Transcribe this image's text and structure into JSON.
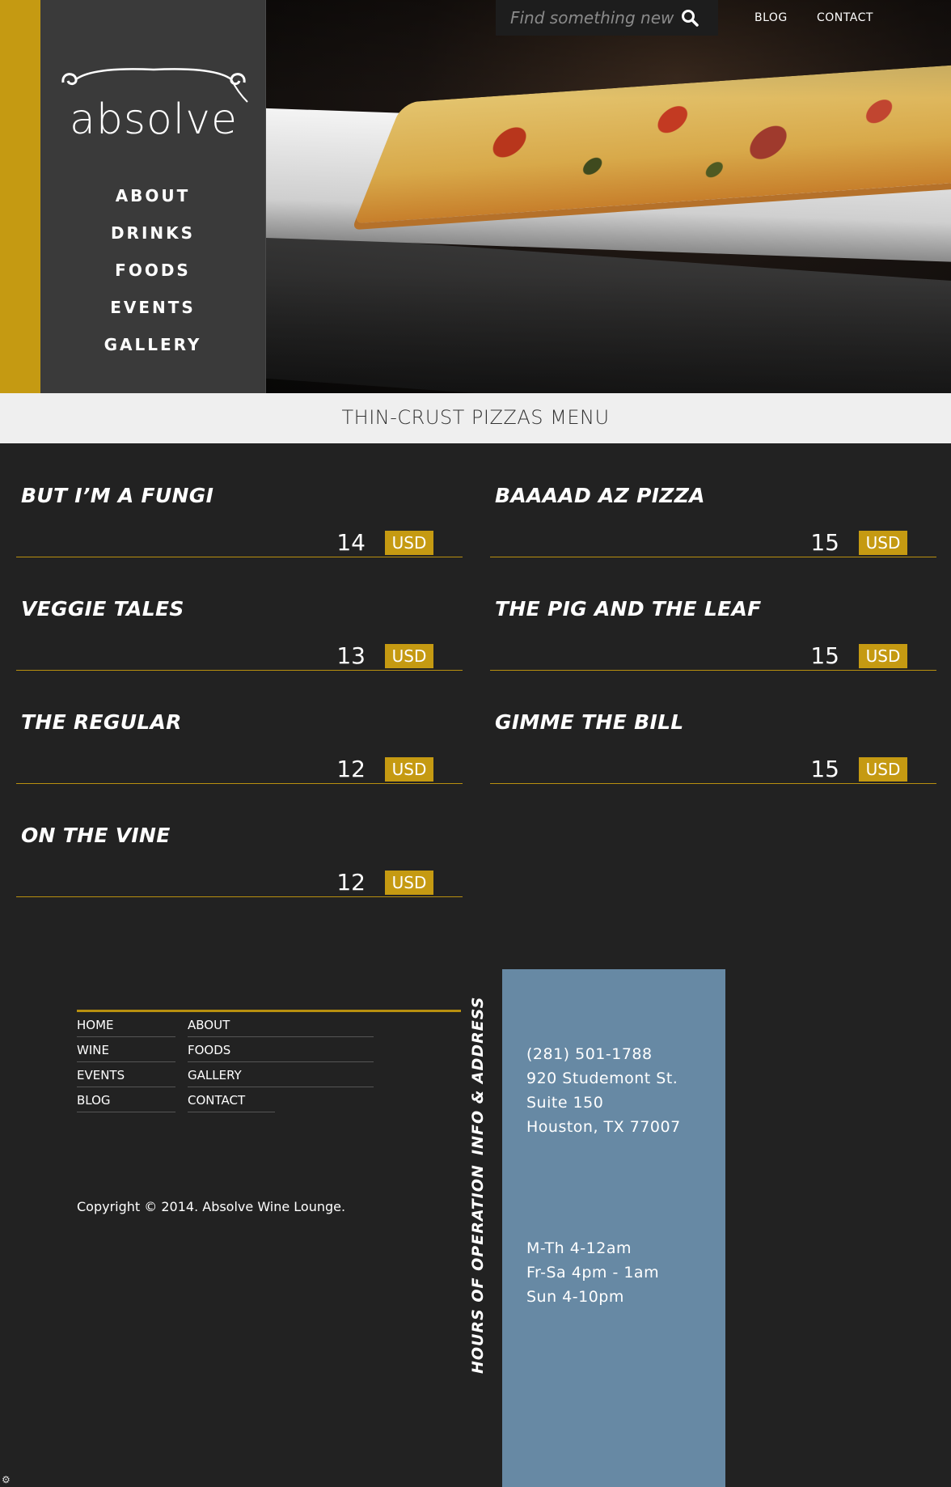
{
  "brand": {
    "logo_text": "absolve",
    "accent": "#c59a12",
    "panel_color": "#6789a4"
  },
  "sidebar": {
    "items": [
      {
        "label": "ABOUT"
      },
      {
        "label": "DRINKS"
      },
      {
        "label": "FOODS"
      },
      {
        "label": "EVENTS"
      },
      {
        "label": "GALLERY"
      }
    ]
  },
  "header": {
    "search_placeholder": "Find something new",
    "search_icon": "search-icon",
    "links": [
      {
        "label": "BLOG"
      },
      {
        "label": "CONTACT"
      }
    ]
  },
  "page_title": "THIN-CRUST PIZZAS MENU",
  "menu": {
    "items": [
      {
        "name": "BUT I’M A FUNGI",
        "price": "14",
        "currency": "USD"
      },
      {
        "name": "BAAAAD AZ PIZZA",
        "price": "15",
        "currency": "USD"
      },
      {
        "name": "VEGGIE TALES",
        "price": "13",
        "currency": "USD"
      },
      {
        "name": "THE PIG AND THE LEAF",
        "price": "15",
        "currency": "USD"
      },
      {
        "name": "THE REGULAR",
        "price": "12",
        "currency": "USD"
      },
      {
        "name": "GIMME THE BILL",
        "price": "15",
        "currency": "USD"
      },
      {
        "name": "ON THE VINE",
        "price": "12",
        "currency": "USD"
      }
    ]
  },
  "footer": {
    "links": [
      {
        "label": "HOME"
      },
      {
        "label": "ABOUT"
      },
      {
        "label": "WINE"
      },
      {
        "label": "FOODS"
      },
      {
        "label": "EVENTS"
      },
      {
        "label": "GALLERY"
      },
      {
        "label": "BLOG"
      },
      {
        "label": "CONTACT"
      }
    ],
    "copyright": "Copyright © 2014. Absolve Wine Lounge.",
    "info_label": "INFO & ADDRESS",
    "hours_label": "HOURS OF OPERATION",
    "address": [
      "(281) 501-1788",
      "920 Studemont St.",
      "Suite 150",
      "Houston, TX 77007"
    ],
    "hours": [
      "M-Th 4-12am",
      "Fr-Sa 4pm - 1am",
      "Sun 4-10pm"
    ]
  }
}
